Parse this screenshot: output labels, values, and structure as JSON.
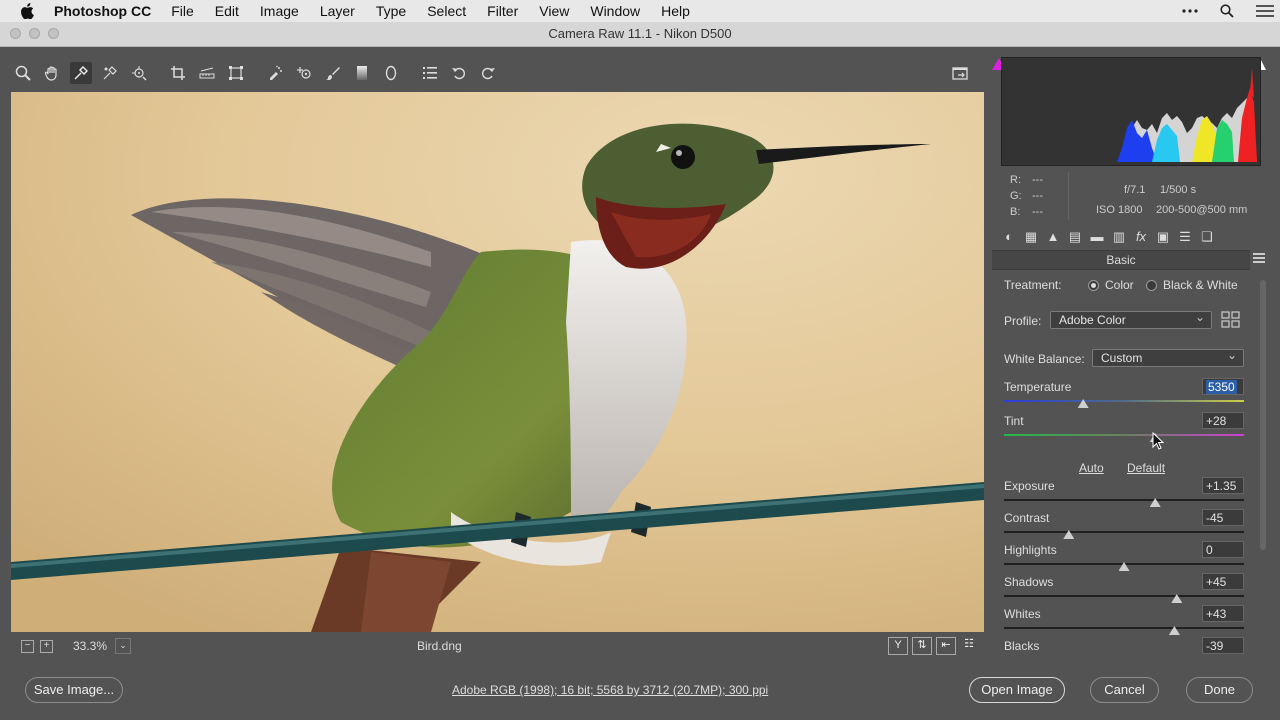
{
  "menubar": {
    "app_name": "Photoshop CC",
    "items": [
      "File",
      "Edit",
      "Image",
      "Layer",
      "Type",
      "Select",
      "Filter",
      "View",
      "Window",
      "Help"
    ],
    "right_icons": [
      "more-icon",
      "search-icon",
      "list-icon"
    ]
  },
  "window": {
    "title": "Camera Raw 11.1  -  Nikon D500"
  },
  "tools": [
    "zoom-tool-icon",
    "hand-tool-icon",
    "white-balance-tool-icon",
    "color-sampler-icon",
    "targeted-adjustment-icon",
    "crop-tool-icon",
    "straighten-tool-icon",
    "transform-tool-icon",
    "spot-removal-icon",
    "red-eye-icon",
    "adjustment-brush-icon",
    "graduated-filter-icon",
    "radial-filter-icon",
    "preferences-icon",
    "rotate-left-icon",
    "rotate-right-icon"
  ],
  "image": {
    "filename": "Bird.dng",
    "zoom": "33.3%"
  },
  "readout": {
    "r_label": "R:",
    "r_value": "---",
    "g_label": "G:",
    "g_value": "---",
    "b_label": "B:",
    "b_value": "---",
    "aperture": "f/7.1",
    "shutter": "1/500 s",
    "iso": "ISO 1800",
    "lens": "200-500@500 mm"
  },
  "panel": {
    "title": "Basic",
    "treatment_label": "Treatment:",
    "treatment_options": [
      "Color",
      "Black & White"
    ],
    "treatment_selected": "Color",
    "profile_label": "Profile:",
    "profile_value": "Adobe Color",
    "wb_label": "White Balance:",
    "wb_value": "Custom",
    "auto_link": "Auto",
    "default_link": "Default",
    "sliders": [
      {
        "label": "Temperature",
        "value": "5350",
        "position": 0.33
      },
      {
        "label": "Tint",
        "value": "+28",
        "position": 0.63
      },
      {
        "label": "Exposure",
        "value": "+1.35",
        "position": 0.63
      },
      {
        "label": "Contrast",
        "value": "-45",
        "position": 0.27
      },
      {
        "label": "Highlights",
        "value": "0",
        "position": 0.5
      },
      {
        "label": "Shadows",
        "value": "+45",
        "position": 0.72
      },
      {
        "label": "Whites",
        "value": "+43",
        "position": 0.71
      },
      {
        "label": "Blacks",
        "value": "-39",
        "position": 0.3
      }
    ]
  },
  "bottom": {
    "save_label": "Save Image...",
    "workflow_text": "Adobe RGB (1998); 16 bit; 5568 by 3712 (20.7MP); 300 ppi",
    "open_label": "Open Image",
    "cancel_label": "Cancel",
    "done_label": "Done"
  },
  "colors": {
    "accent_selection": "#2c5ea8",
    "shadow_clip": "#dd22dd",
    "panel_bg": "#535353"
  }
}
